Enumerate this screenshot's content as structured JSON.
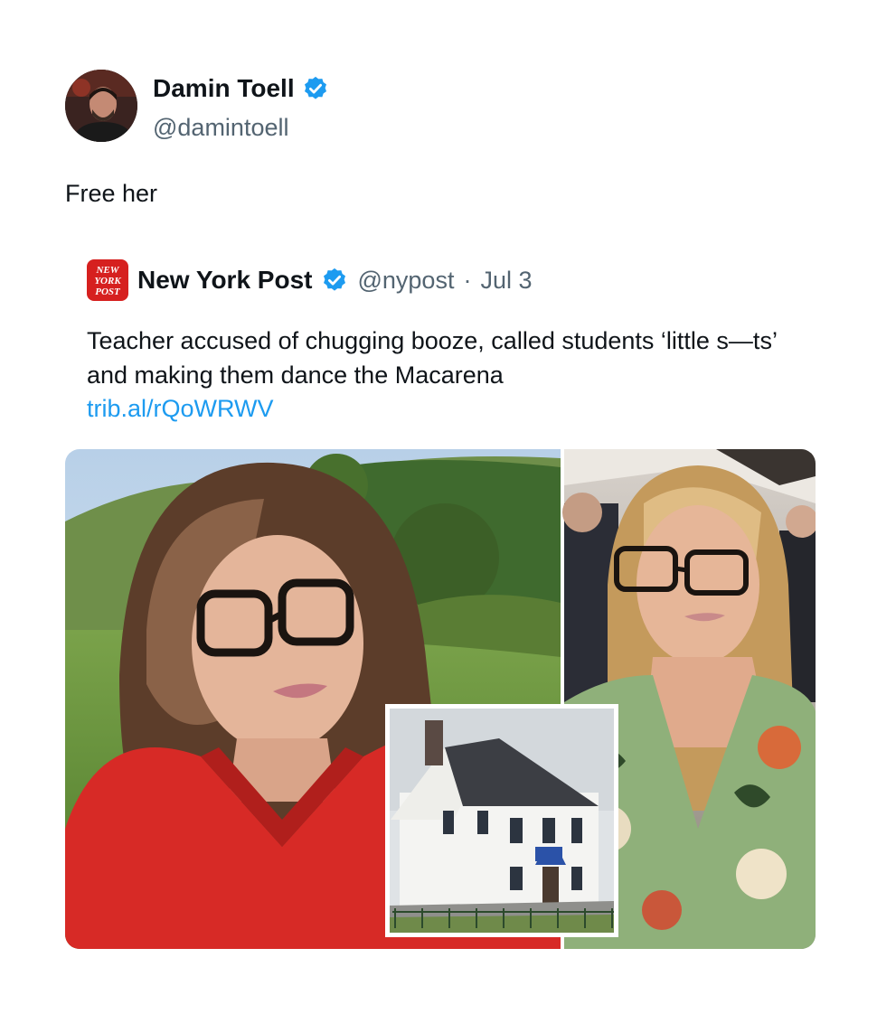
{
  "tweet": {
    "author_name": "Damin Toell",
    "handle": "@damintoell",
    "verified": true,
    "text": "Free her"
  },
  "quote": {
    "source_name": "New York Post",
    "logo_text": [
      "NEW",
      "YORK",
      "POST"
    ],
    "handle": "@nypost",
    "separator": "·",
    "date": "Jul 3",
    "verified": true,
    "text": "Teacher accused of chugging booze, called students ‘little s—ts’ and making them dance the Macarena",
    "link": "trib.al/rQoWRWV"
  },
  "colors": {
    "verified_badge": "#1d9bf0",
    "link": "#1d9bf0",
    "nypost_red": "#d6201f",
    "secondary_text": "#536471"
  },
  "icons": {
    "verified": "verified-badge-icon"
  },
  "media": {
    "images": [
      "selfie-photo",
      "portrait-photo",
      "school-building-photo"
    ]
  }
}
